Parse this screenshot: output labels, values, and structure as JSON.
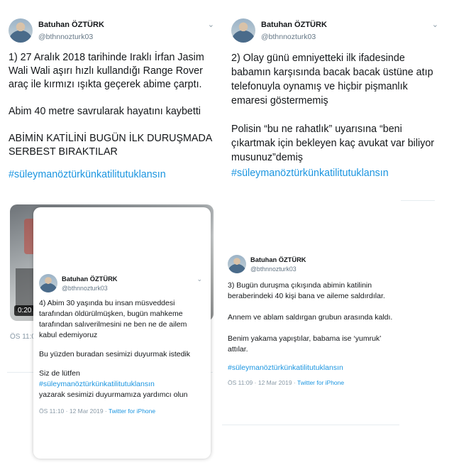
{
  "tweets": [
    {
      "name": "Batuhan ÖZTÜRK",
      "handle": "@bthnnozturk03",
      "text": "1) 27 Aralık 2018 tarihinde Iraklı İrfan Jasim Wali Wali aşırı hızlı kullandığı Range Rover araç ile kırmızı ışıkta geçerek abime çarptı.\n\nAbim 40 metre savrularak hayatını kaybetti\n\nABİMİN KATİLİNİ BUGÜN İLK DURUŞMADA SERBEST BIRAKTILAR",
      "hashtag": "#süleymanöztürkünkatilitutuklansın"
    },
    {
      "name": "Batuhan ÖZTÜRK",
      "handle": "@bthnnozturk03",
      "text": "2) Olay günü emniyetteki ilk ifadesinde babamın karşısında bacak bacak üstüne atıp telefonuyla oynamış ve hiçbir pişmanlık emaresi göstermemiş\n\nPolisin “bu ne rahatlık” uyarısına “beni çıkartmak için bekleyen kaç avukat var biliyor musunuz”demiş",
      "hashtag": "#süleymanöztürkünkatilitutuklansın"
    },
    {
      "name": "Batuhan ÖZTÜRK",
      "handle": "@bthnnozturk03",
      "text": "3) Bugün duruşma çıkışında abimin katilinin beraberindeki 40 kişi bana ve aileme saldırdılar.\n\nAnnem ve ablam saldırgan grubun arasında kaldı.\n\nBenim yakama yapıştılar, babama ise ‘yumruk’ attılar.",
      "hashtag": "#süleymanöztürkünkatilitutuklansın",
      "time": "ÖS 11:09 · 12 Mar 2019 · ",
      "source": "Twitter for iPhone"
    },
    {
      "name": "Batuhan ÖZTÜRK",
      "handle": "@bthnnozturk03",
      "text": "4) Abim 30 yaşında bu insan müsveddesi tarafından öldürülmüşken, bugün mahkeme tarafından salıverilmesini ne ben ne de ailem kabul edemiyoruz",
      "text2": "Bu yüzden buradan sesimizi duyurmak istedik",
      "text3": "Siz de lütfen",
      "hashtag": "#süleymanöztürkünkatilitutuklansın",
      "text4": "yazarak sesimizi duyurmamıza yardımcı olun",
      "time": "ÖS 11:10 · 12 Mar 2019 · ",
      "source": "Twitter for iPhone"
    }
  ],
  "video": {
    "duration": "0:20",
    "time_partial": "ÖS 11:0"
  },
  "icons": {
    "caret": "chevron-down-icon",
    "avatar": "profile-photo"
  },
  "colors": {
    "hashtag": "#1b95e0",
    "meta": "#8899a6",
    "text": "#14171a"
  }
}
